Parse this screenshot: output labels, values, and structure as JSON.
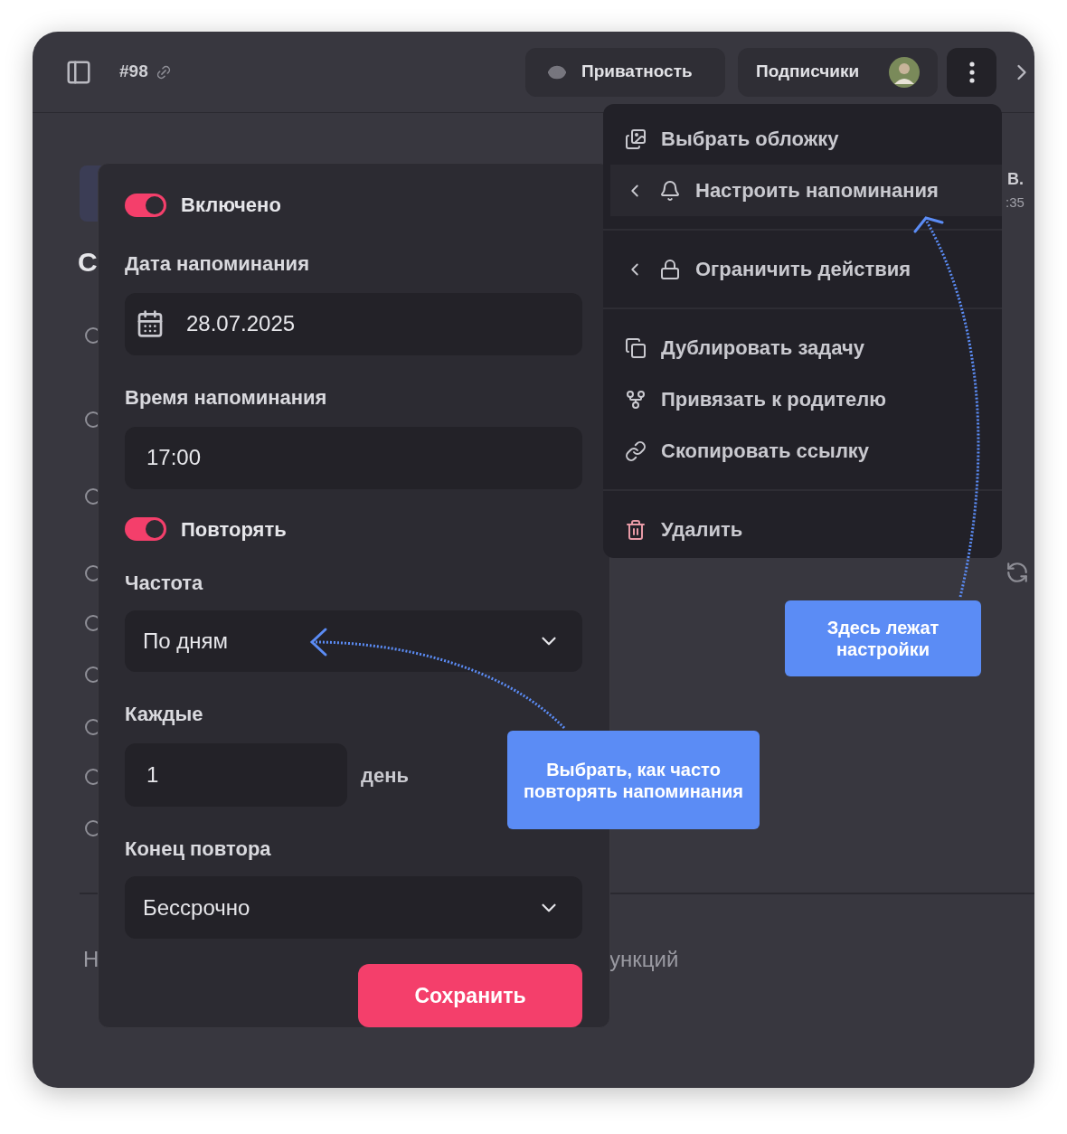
{
  "header": {
    "task_id": "#98",
    "privacy_button": "Приватность",
    "subscribers_button": "Подписчики"
  },
  "background": {
    "heading_fragment": "С",
    "author_fragment": "В.",
    "time_fragment": ":35",
    "footer_left_fragment": "Н",
    "footer_right_fragment": "ункций"
  },
  "menu": {
    "groups": [
      [
        {
          "kind": "normal",
          "label": "Выбрать обложку",
          "submenu": false,
          "selected": false
        },
        {
          "kind": "normal",
          "label": "Настроить напоминания",
          "submenu": true,
          "selected": true
        }
      ],
      [
        {
          "kind": "normal",
          "label": "Ограничить действия",
          "submenu": true,
          "selected": false
        }
      ],
      [
        {
          "kind": "normal",
          "label": "Дублировать задачу",
          "submenu": false,
          "selected": false
        },
        {
          "kind": "normal",
          "label": "Привязать к родителю",
          "submenu": false,
          "selected": false
        },
        {
          "kind": "normal",
          "label": "Скопировать ссылку",
          "submenu": false,
          "selected": false
        }
      ],
      [
        {
          "kind": "danger",
          "label": "Удалить",
          "submenu": false,
          "selected": false
        }
      ]
    ]
  },
  "reminder": {
    "enabled_toggle": {
      "label": "Включено",
      "on": true
    },
    "date_label": "Дата напоминания",
    "date_value": "28.07.2025",
    "time_label": "Время напоминания",
    "time_value": "17:00",
    "repeat_toggle": {
      "label": "Повторять",
      "on": true
    },
    "frequency_label": "Частота",
    "frequency_value": "По дням",
    "every_label": "Каждые",
    "every_value": "1",
    "every_unit": "день",
    "end_label": "Конец повтора",
    "end_value": "Бессрочно",
    "save_button": "Сохранить"
  },
  "callouts": [
    "Здесь лежат настройки",
    "Выбрать, как часто повторять напоминания"
  ]
}
